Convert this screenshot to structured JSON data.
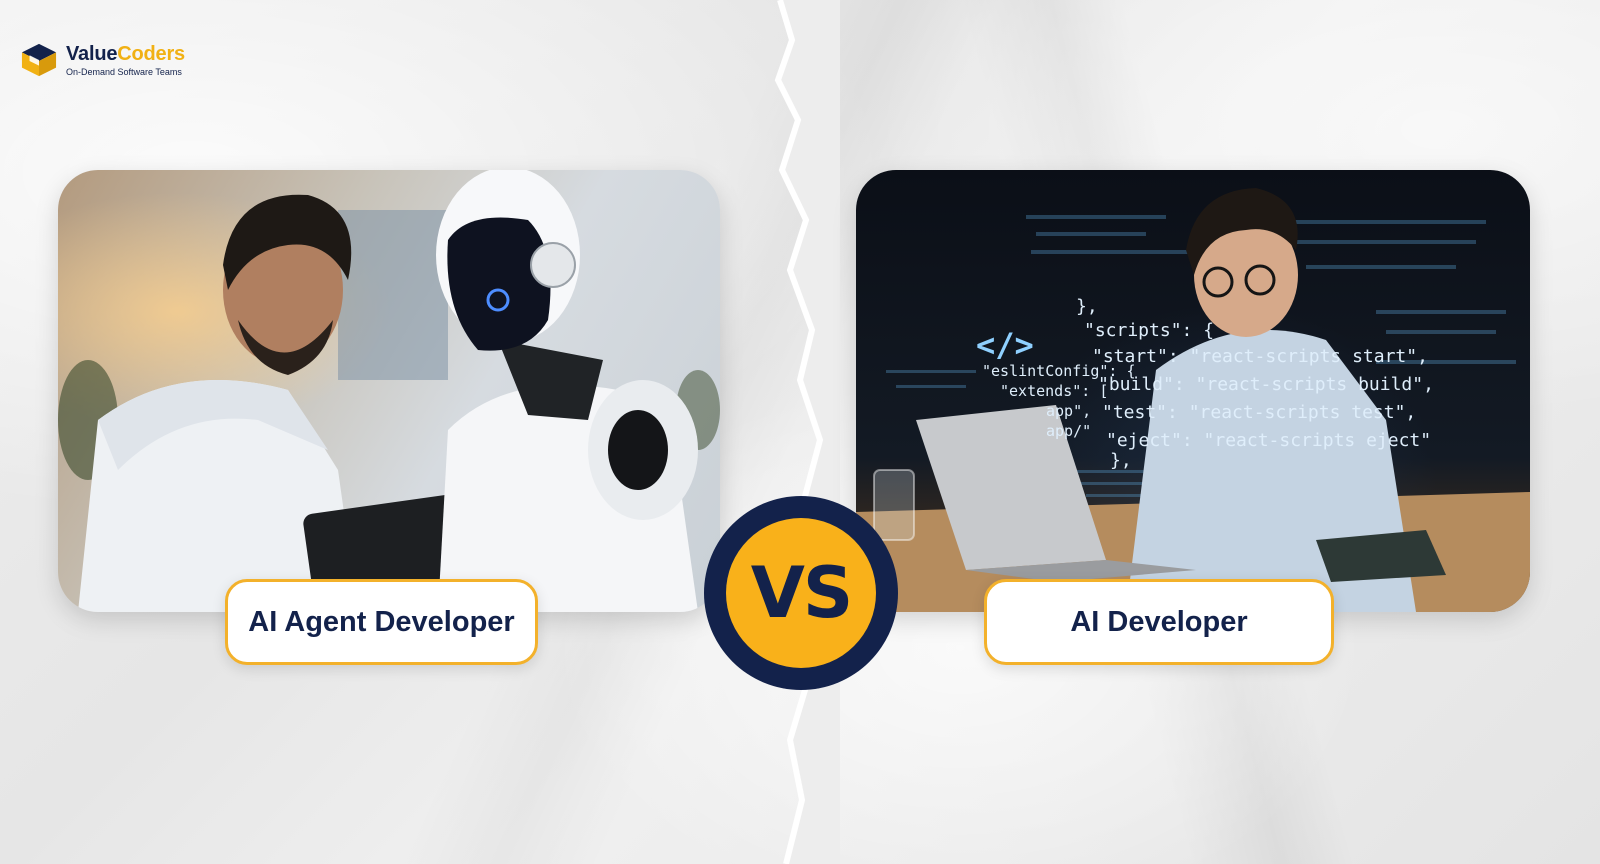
{
  "brand": {
    "name_part1": "Value",
    "name_part2": "Coders",
    "tagline": "On-Demand Software Teams",
    "colors": {
      "navy": "#13224b",
      "gold": "#f1b114"
    }
  },
  "comparison": {
    "left_label": "AI Agent Developer",
    "right_label": "AI Developer",
    "vs_text": "VS"
  },
  "right_image": {
    "code_lines": [
      "},",
      "\"scripts\": {",
      "\"start\": \"react-scripts start\",",
      "\"build\": \"react-scripts build\",",
      "\"test\": \"react-scripts test\",",
      "\"eject\": \"react-scripts eject\"",
      "},",
      "\"eslintConfig\": {",
      "\"extends\": [",
      "app\",",
      "app/\""
    ],
    "code_symbol": "</>"
  }
}
